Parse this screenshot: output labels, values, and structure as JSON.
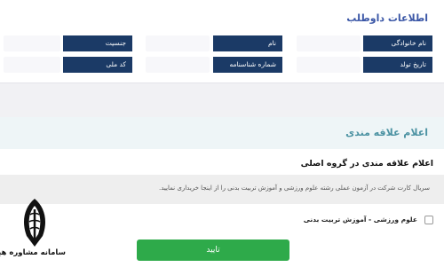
{
  "candidate_info": {
    "title": "اطلاعات داوطلب",
    "fields": {
      "last_name": "نام خانوادگی",
      "first_name": "نام",
      "gender": "جنسیت",
      "birth_date": "تاریخ تولد",
      "id_number": "شماره شناسنامه",
      "national_code": "کد ملی"
    }
  },
  "interest": {
    "header_title": "اعلام علاقه مندی",
    "group_title": "اعلام علاقه مندی در گروه اصلی",
    "notice": "سریال کارت شرکت در آزمون عملی رشته علوم ورزشی و آموزش تربیت بدنی را از اینجا خریداری نمایید.",
    "option_label": "علوم ورزشی - آموزش تربیت بدنی",
    "option_checked": false
  },
  "confirm_button": "تایید",
  "watermark": {
    "text": "سامانه مشاوره هیوا"
  },
  "colors": {
    "label_bg": "#1b3a66",
    "header_title": "#3a56a6",
    "interest_title": "#4d93a3",
    "confirm_bg": "#2eaa4a"
  }
}
